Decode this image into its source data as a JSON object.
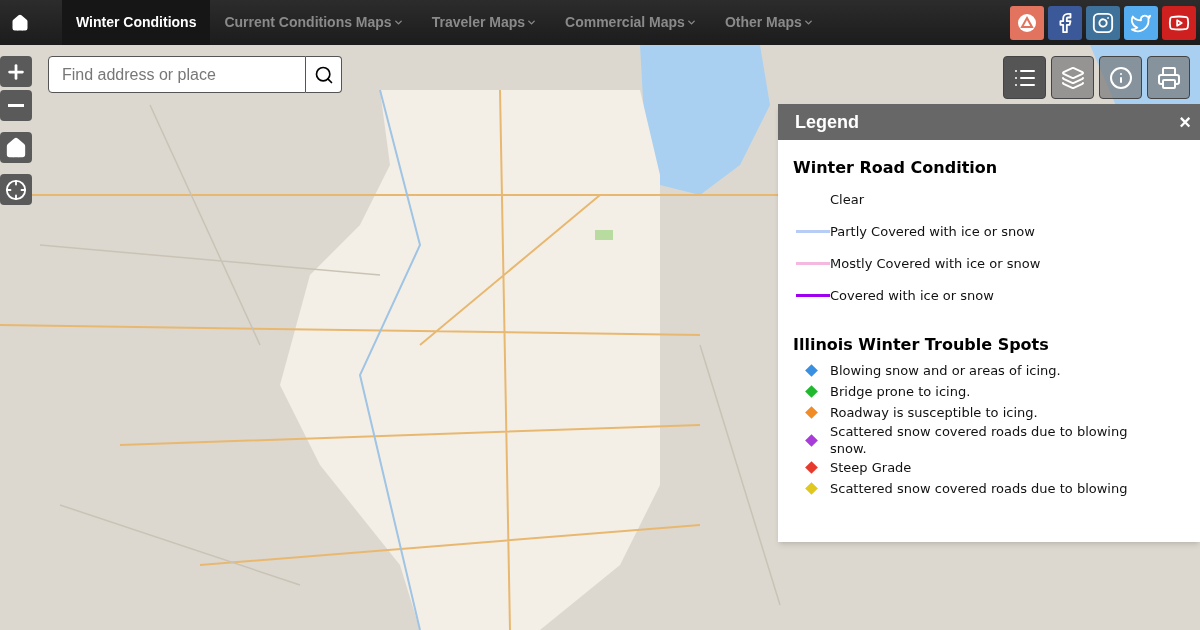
{
  "nav": {
    "items": [
      {
        "label": "Winter Conditions",
        "selected": true,
        "dropdown": false
      },
      {
        "label": "Current Conditions Maps",
        "selected": false,
        "dropdown": true
      },
      {
        "label": "Traveler Maps",
        "selected": false,
        "dropdown": true
      },
      {
        "label": "Commercial Maps",
        "selected": false,
        "dropdown": true
      },
      {
        "label": "Other Maps",
        "selected": false,
        "dropdown": true
      }
    ],
    "social": [
      {
        "kind": "app",
        "color": "#e2735f"
      },
      {
        "kind": "facebook",
        "color": "#3b5998"
      },
      {
        "kind": "instagram",
        "color": "#3f729b"
      },
      {
        "kind": "twitter",
        "color": "#55acee"
      },
      {
        "kind": "youtube",
        "color": "#cd201f"
      }
    ]
  },
  "search": {
    "placeholder": "Find address or place"
  },
  "map_tools": [
    {
      "kind": "legend",
      "selected": true
    },
    {
      "kind": "layers",
      "selected": false
    },
    {
      "kind": "info",
      "selected": false
    },
    {
      "kind": "print",
      "selected": false
    }
  ],
  "legend": {
    "title": "Legend",
    "close": "×",
    "sections": [
      {
        "title": "Winter Road Condition",
        "kind": "line",
        "items": [
          {
            "label": "Clear"
          },
          {
            "label": "Partly Covered with ice or snow",
            "color": "#b8cdf5"
          },
          {
            "label": "Mostly Covered with ice or snow",
            "color": "#f5b8e0"
          },
          {
            "label": "Covered with ice or snow",
            "color": "#a000f0"
          }
        ]
      },
      {
        "title": "Illinois Winter Trouble Spots",
        "kind": "diamond",
        "items": [
          {
            "label": "Blowing snow and or areas of icing.",
            "color": "#3b8fe0"
          },
          {
            "label": "Bridge prone to icing.",
            "color": "#1fb82e"
          },
          {
            "label": "Roadway is susceptible to icing.",
            "color": "#f08c28"
          },
          {
            "label": "Scattered snow covered roads due to blowing snow.",
            "color": "#a83cd8"
          },
          {
            "label": "Steep Grade",
            "color": "#e83a2c"
          },
          {
            "label": "Scattered snow covered roads due to blowing",
            "color": "#e0c820"
          }
        ]
      }
    ]
  }
}
